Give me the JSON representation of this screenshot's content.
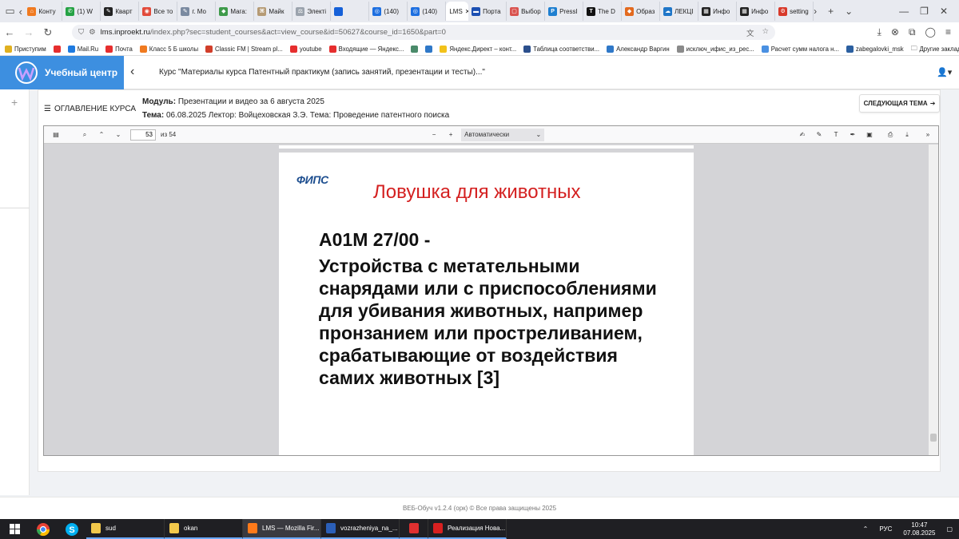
{
  "browser": {
    "tabs": [
      {
        "label": "Конту",
        "color": "#f07a20",
        "glyph": "⌂"
      },
      {
        "label": "(1) W",
        "color": "#25a244",
        "glyph": "✆"
      },
      {
        "label": "Кварт",
        "color": "#222222",
        "glyph": "✎"
      },
      {
        "label": "Все то",
        "color": "#e24a3a",
        "glyph": "◉"
      },
      {
        "label": "г. Мо",
        "color": "#7a8aa0",
        "glyph": "✎"
      },
      {
        "label": "Мага:",
        "color": "#3e9a4a",
        "glyph": "◆"
      },
      {
        "label": "Майк",
        "color": "#b59a74",
        "glyph": "⌘"
      },
      {
        "label": "Электі",
        "color": "#9ba3ad",
        "glyph": "⚖"
      },
      {
        "label": "",
        "color": "#1560d8",
        "glyph": ""
      },
      {
        "label": "(140)",
        "color": "#1d6fe0",
        "glyph": "◎"
      },
      {
        "label": "(140)",
        "color": "#1d6fe0",
        "glyph": "◎"
      }
    ],
    "active_tab": {
      "label": "LMS",
      "close": "✕"
    },
    "tabs_after": [
      {
        "label": "Порта",
        "color": "#1b4fb2",
        "glyph": "▬"
      },
      {
        "label": "Выбор",
        "color": "#d9534f",
        "glyph": "▢"
      },
      {
        "label": "PressI",
        "color": "#1e7fd0",
        "glyph": "P"
      },
      {
        "label": "The D",
        "color": "#111111",
        "glyph": "T"
      },
      {
        "label": "Образ",
        "color": "#e36a1f",
        "glyph": "◆"
      },
      {
        "label": "ЛЕКЦІ",
        "color": "#1f76c8",
        "glyph": "☁"
      },
      {
        "label": "Инфо",
        "color": "#222222",
        "glyph": "▦"
      },
      {
        "label": "Инфо",
        "color": "#222222",
        "glyph": "▦"
      },
      {
        "label": "setting",
        "color": "#d83a2b",
        "glyph": "⚙"
      }
    ],
    "url_host": "lms.inproekt.ru",
    "url_path": "/index.php?sec=student_courses&act=view_course&id=50627&course_id=1650&part=0"
  },
  "bookmarks": [
    {
      "label": "Приступим",
      "color": "#e0b020"
    },
    {
      "label": "",
      "color": "#e62e2e"
    },
    {
      "label": "Mail.Ru",
      "color": "#1e7ae0"
    },
    {
      "label": "Почта",
      "color": "#e62e2e"
    },
    {
      "label": "Класс 5 Б школы",
      "color": "#f07a20"
    },
    {
      "label": "Classic FM | Stream pl...",
      "color": "#d13e2a"
    },
    {
      "label": "youtube",
      "color": "#e62e2e"
    },
    {
      "label": "Входящие — Яндекс...",
      "color": "#e62e2e"
    },
    {
      "label": "",
      "color": "#4a8a6a"
    },
    {
      "label": "",
      "color": "#2f78c8"
    },
    {
      "label": "Яндекс.Директ – конт...",
      "color": "#f2c21a"
    },
    {
      "label": "Таблица соответстви...",
      "color": "#2b4f8c"
    },
    {
      "label": "Александр Варгин",
      "color": "#2f78c8"
    },
    {
      "label": "исключ_ифис_из_рес...",
      "color": "#8a8a8a"
    },
    {
      "label": "Расчет сумм налога н...",
      "color": "#4a90e2"
    },
    {
      "label": "zabegalovki_msk",
      "color": "#2b5fa0"
    }
  ],
  "bookmarks_other": "Другие закладки",
  "lms": {
    "brand": "Учебный центр",
    "course_title": "Курс \"Материалы курса Патентный практикум (запись занятий, презентации и тесты)...\"",
    "toc_label": "ОГЛАВЛЕНИЕ КУРСА",
    "module_key": "Модуль:",
    "module_value": " Презентации и видео за 6 августа 2025",
    "topic_key": "Тема:",
    "topic_value": " 06.08.2025 Лектор: Войцеховская З.Э. Тема: Проведение патентного поиска",
    "next_label": "СЛЕДУЮЩАЯ ТЕМА"
  },
  "pdf": {
    "page_current": "53",
    "page_of": "из 54",
    "zoom": "Автоматически",
    "slide": {
      "logo": "ФИПС",
      "title": "Ловушка для животных",
      "code": "A01M 27/00 -",
      "description": "Устройства с метательными снарядами или с приспособлениями для убивания животных, например пронзанием или простреливанием, срабатывающие от воздействия самих животных [3]"
    }
  },
  "footer": "ВЕБ-Обуч v1.2.4 (орк) © Все права защищены 2025",
  "taskbar": {
    "apps": [
      {
        "label": "sud",
        "color": "#f2c84b"
      },
      {
        "label": "okan",
        "color": "#f2c84b"
      },
      {
        "label": "LMS — Mozilla Fir...",
        "color": "#ff7a1a"
      },
      {
        "label": "vozrazheniya_na_...",
        "color": "#2b5fb8"
      },
      {
        "label": "",
        "color": "#e03030"
      },
      {
        "label": "Реализация Нова...",
        "color": "#d82020"
      }
    ],
    "lang": "РУС",
    "time": "10:47",
    "date": "07.08.2025"
  }
}
